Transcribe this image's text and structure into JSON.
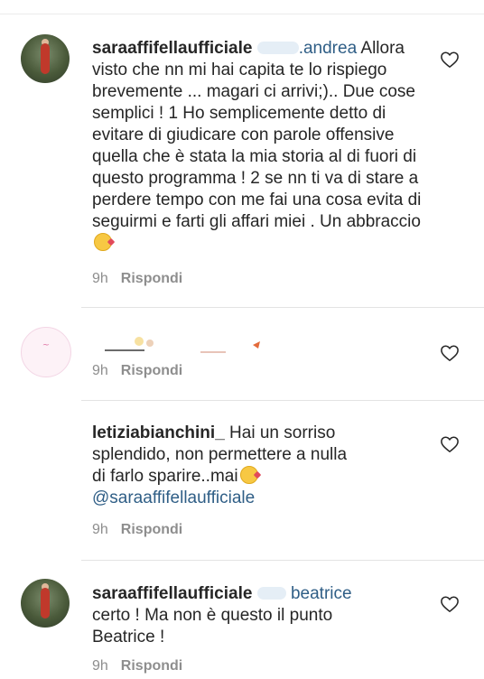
{
  "comments": [
    {
      "username": "saraaffifellaufficiale",
      "mention": ".andrea",
      "text": "Allora visto che nn mi hai capita te lo rispiego brevemente ... magari ci arrivi;).. Due cose semplici ! 1 Ho semplicemente detto di evitare di giudicare con parole offensive quella che è stata la mia storia al di fuori di questo programma ! 2 se nn ti va di stare a perdere tempo con me fai una cosa evita di seguirmi e farti gli affari miei . Un abbraccio",
      "time": "9h",
      "reply_label": "Rispondi",
      "emoji": "kissing-heart-emoji"
    },
    {
      "username": "",
      "text": "",
      "time": "9h",
      "reply_label": "Rispondi"
    },
    {
      "username": "letiziabianchini_",
      "text": "Hai un sorriso splendido, non permettere a nulla di farlo sparire..mai",
      "mention_after": "@saraaffifellaufficiale",
      "time": "9h",
      "reply_label": "Rispondi",
      "emoji": "kissing-heart-emoji"
    },
    {
      "username": "saraaffifellaufficiale",
      "mention": "beatrice",
      "text": "certo ! Ma non è questo il punto Beatrice !",
      "time": "9h",
      "reply_label": "Rispondi"
    }
  ],
  "icons": {
    "like": "heart-outline-icon"
  },
  "colors": {
    "text": "#262626",
    "meta": "#8e8e8e",
    "mention": "#2f5e86",
    "divider": "#e3e3e3"
  }
}
